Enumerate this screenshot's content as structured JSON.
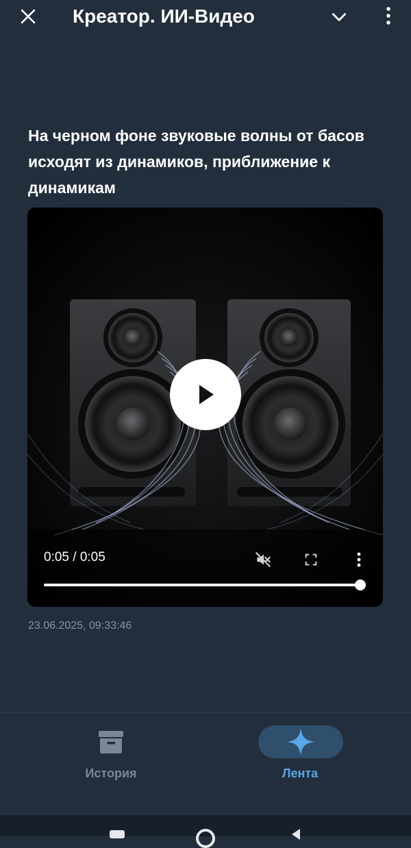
{
  "header": {
    "title": "Креатор. ИИ-Видео",
    "icons": {
      "close": "close-icon",
      "dropdown": "chevron-down-icon",
      "more": "more-vertical-icon"
    }
  },
  "post": {
    "prompt": "На черном фоне звуковые волны от басов исходят из динамиков, приближение к динамикам",
    "timestamp": "23.06.2025, 09:33:46"
  },
  "video": {
    "time_display": "0:05 / 0:05",
    "progress": 1.0,
    "icons": {
      "play": "play-icon",
      "mute": "volume-muted-icon",
      "fullscreen": "fullscreen-icon",
      "more": "more-vertical-icon"
    }
  },
  "bottom_nav": {
    "items": [
      {
        "label": "История",
        "icon": "archive-icon",
        "active": false
      },
      {
        "label": "Лента",
        "icon": "sparkle-icon",
        "active": true
      }
    ]
  },
  "colors": {
    "background": "#222e3c",
    "accent": "#5aa7e8",
    "active_pill": "#2f4f6c",
    "muted_text": "#8593a3",
    "inactive_nav": "#7b8794"
  }
}
